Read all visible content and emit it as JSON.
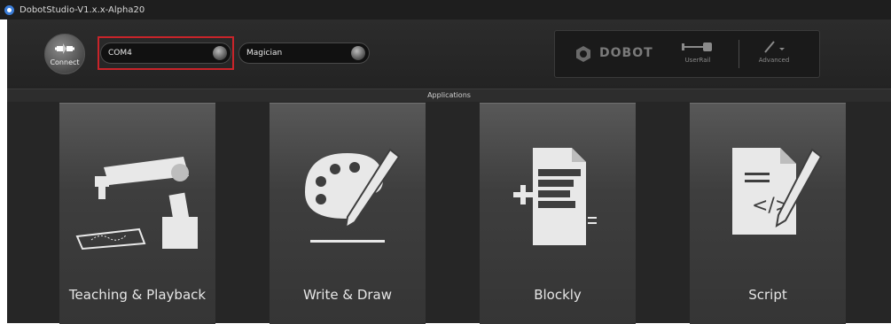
{
  "window": {
    "title": "DobotStudio-V1.x.x-Alpha20"
  },
  "toolbar": {
    "connect_label": "Connect",
    "port_value": "COM4",
    "model_value": "Magician",
    "brand_name": "DOBOT",
    "user_rail_label": "UserRail",
    "advanced_label": "Advanced"
  },
  "applications": {
    "section_label": "Applications",
    "items": [
      {
        "label": "Teaching & Playback"
      },
      {
        "label": "Write & Draw"
      },
      {
        "label": "Blockly"
      },
      {
        "label": "Script"
      }
    ]
  },
  "highlight_color": "#c8242a"
}
